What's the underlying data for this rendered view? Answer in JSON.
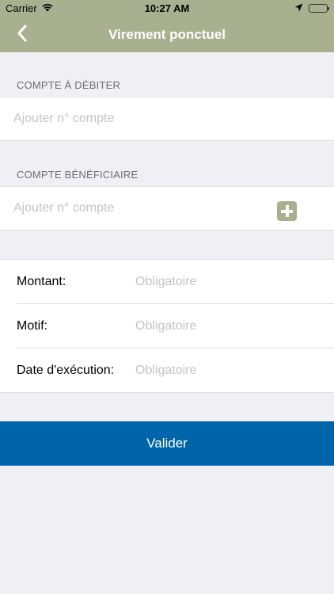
{
  "status_bar": {
    "carrier": "Carrier",
    "time": "10:27 AM",
    "icons": [
      "wifi-icon",
      "location-arrow-icon",
      "battery-icon"
    ]
  },
  "nav": {
    "back_icon": "chevron-left-icon",
    "title": "Virement ponctuel"
  },
  "debit": {
    "header": "COMPTE À DÉBITER",
    "placeholder": "Ajouter n° compte",
    "value": ""
  },
  "beneficiary": {
    "header": "COMPTE BÉNÉFICIAIRE",
    "placeholder": "Ajouter n° compte",
    "value": "",
    "add_icon": "plus-square-icon"
  },
  "form": {
    "amount": {
      "label": "Montant:",
      "placeholder": "Obligatoire",
      "value": ""
    },
    "reason": {
      "label": "Motif:",
      "placeholder": "Obligatoire",
      "value": ""
    },
    "date": {
      "label": "Date d'exécution:",
      "placeholder": "Obligatoire",
      "value": ""
    }
  },
  "submit_label": "Valider",
  "colors": {
    "accent": "#a9b08f",
    "primary_button": "#0064aa",
    "background": "#efeff4"
  }
}
